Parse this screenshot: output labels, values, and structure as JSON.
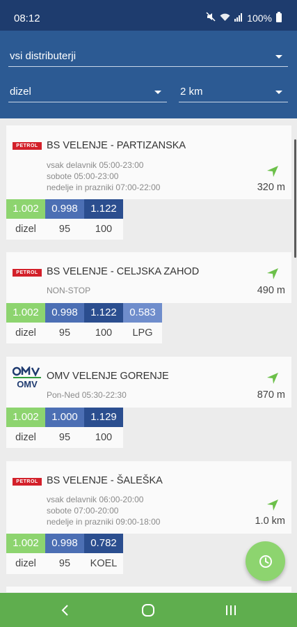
{
  "status_bar": {
    "time": "08:12",
    "battery_text": "100%"
  },
  "filters": {
    "distributor": "vsi distributerji",
    "fuel": "dizel",
    "radius": "2 km"
  },
  "colors": {
    "header": "#2c5a93",
    "statusbar": "#1e3c6e",
    "accent_green": "#8dd46f",
    "navbar": "#5fae4e"
  },
  "stations": [
    {
      "brand": "PETROL",
      "name": "BS VELENJE - PARTIZANSKA",
      "hours": [
        "vsak delavnik 05:00-23:00",
        "sobote 05:00-23:00",
        "nedelje in prazniki 07:00-22:00"
      ],
      "distance": "320 m",
      "prices": [
        {
          "value": "1.002",
          "label": "dizel"
        },
        {
          "value": "0.998",
          "label": "95"
        },
        {
          "value": "1.122",
          "label": "100"
        }
      ]
    },
    {
      "brand": "PETROL",
      "name": "BS VELENJE - CELJSKA ZAHOD",
      "hours": [
        "NON-STOP"
      ],
      "distance": "490 m",
      "prices": [
        {
          "value": "1.002",
          "label": "dizel"
        },
        {
          "value": "0.998",
          "label": "95"
        },
        {
          "value": "1.122",
          "label": "100"
        },
        {
          "value": "0.583",
          "label": "LPG"
        }
      ]
    },
    {
      "brand": "OMV",
      "name": "OMV VELENJE GORENJE",
      "hours": [
        "Pon-Ned 05:30-22:30"
      ],
      "distance": "870 m",
      "prices": [
        {
          "value": "1.002",
          "label": "dizel"
        },
        {
          "value": "1.000",
          "label": "95"
        },
        {
          "value": "1.129",
          "label": "100"
        }
      ]
    },
    {
      "brand": "PETROL",
      "name": "BS VELENJE - ŠALEŠKA",
      "hours": [
        "vsak delavnik 06:00-20:00",
        "sobote 07:00-20:00",
        "nedelje in prazniki 09:00-18:00"
      ],
      "distance": "1.0 km",
      "prices": [
        {
          "value": "1.002",
          "label": "dizel"
        },
        {
          "value": "0.998",
          "label": "95"
        },
        {
          "value": "0.782",
          "label": "KOEL"
        }
      ]
    }
  ]
}
